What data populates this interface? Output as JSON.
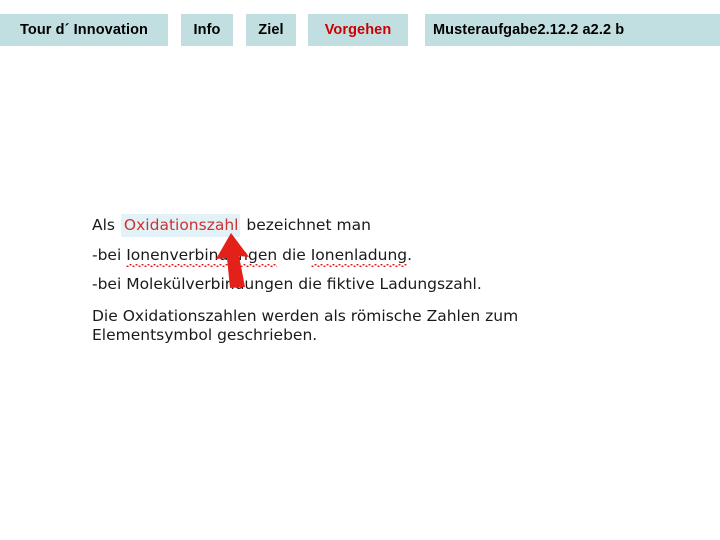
{
  "slide": {
    "background_color": "#ffffff"
  },
  "navbar": {
    "background_color": "#c1dee0",
    "text_color": "#000000",
    "accent_color": "#cc0000",
    "items": [
      {
        "id": "tour",
        "label": "Tour d´ Innovation",
        "accent": false
      },
      {
        "id": "info",
        "label": "Info",
        "accent": false
      },
      {
        "id": "ziel",
        "label": "Ziel",
        "accent": false
      },
      {
        "id": "vorgehen",
        "label": "Vorgehen",
        "accent": true
      }
    ],
    "musteraufgabe": {
      "title": "Musteraufgabe",
      "sub_items": [
        {
          "id": "2-1",
          "label": "2.1"
        },
        {
          "id": "2-2-a",
          "label": "2.2 a"
        },
        {
          "id": "2-2-b",
          "label": "2.2 b"
        }
      ]
    }
  },
  "content": {
    "line1": {
      "prefix": "Als ",
      "highlight": "Oxidationszahl",
      "highlight_color": "#cc3333",
      "highlight_background": "#e3f2f7",
      "suffix": " bezeichnet man"
    },
    "line2": {
      "prefix": "-bei ",
      "misspelled_1": "Ionenverbindungen",
      "middle": " die ",
      "misspelled_2": "Ionenladung",
      "suffix": "."
    },
    "line3": {
      "text": "-bei Molekülverbindungen die fiktive Ladungszahl."
    },
    "paragraph": {
      "text": "Die Oxidationszahlen werden als römische Zahlen zum Elementsymbol geschrieben."
    }
  },
  "annotation": {
    "arrow": {
      "color": "#e32119",
      "direction": "up-left",
      "points_to": "Oxidationszahl"
    }
  }
}
